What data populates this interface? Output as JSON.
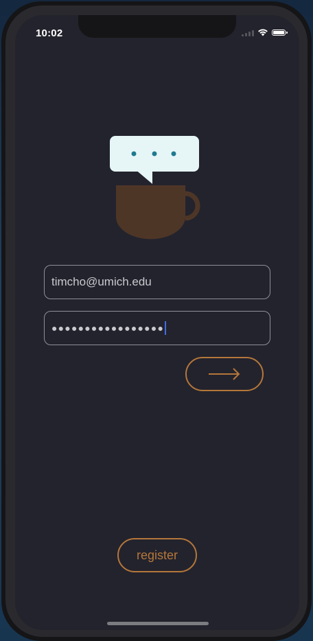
{
  "status_bar": {
    "time": "10:02",
    "icons": [
      "cellular-signal-icon",
      "wifi-icon",
      "battery-icon"
    ]
  },
  "logo": {
    "icon": "coffee-cup-with-chat-bubble-logo",
    "bubble_color": "#e6f6f7",
    "dot_color": "#1f7a8f",
    "cup_color": "#4e3627"
  },
  "login_form": {
    "email_value": "timcho@umich.edu",
    "password_masked": "●●●●●●●●●●●●●●●●●",
    "submit_icon": "arrow-right-icon"
  },
  "register": {
    "label": "register"
  },
  "colors": {
    "screen_background": "#23232d",
    "accent": "#b5773a",
    "field_border": "#8f8f98",
    "field_text": "#c9c9cf",
    "caret": "#3f6fe0"
  }
}
